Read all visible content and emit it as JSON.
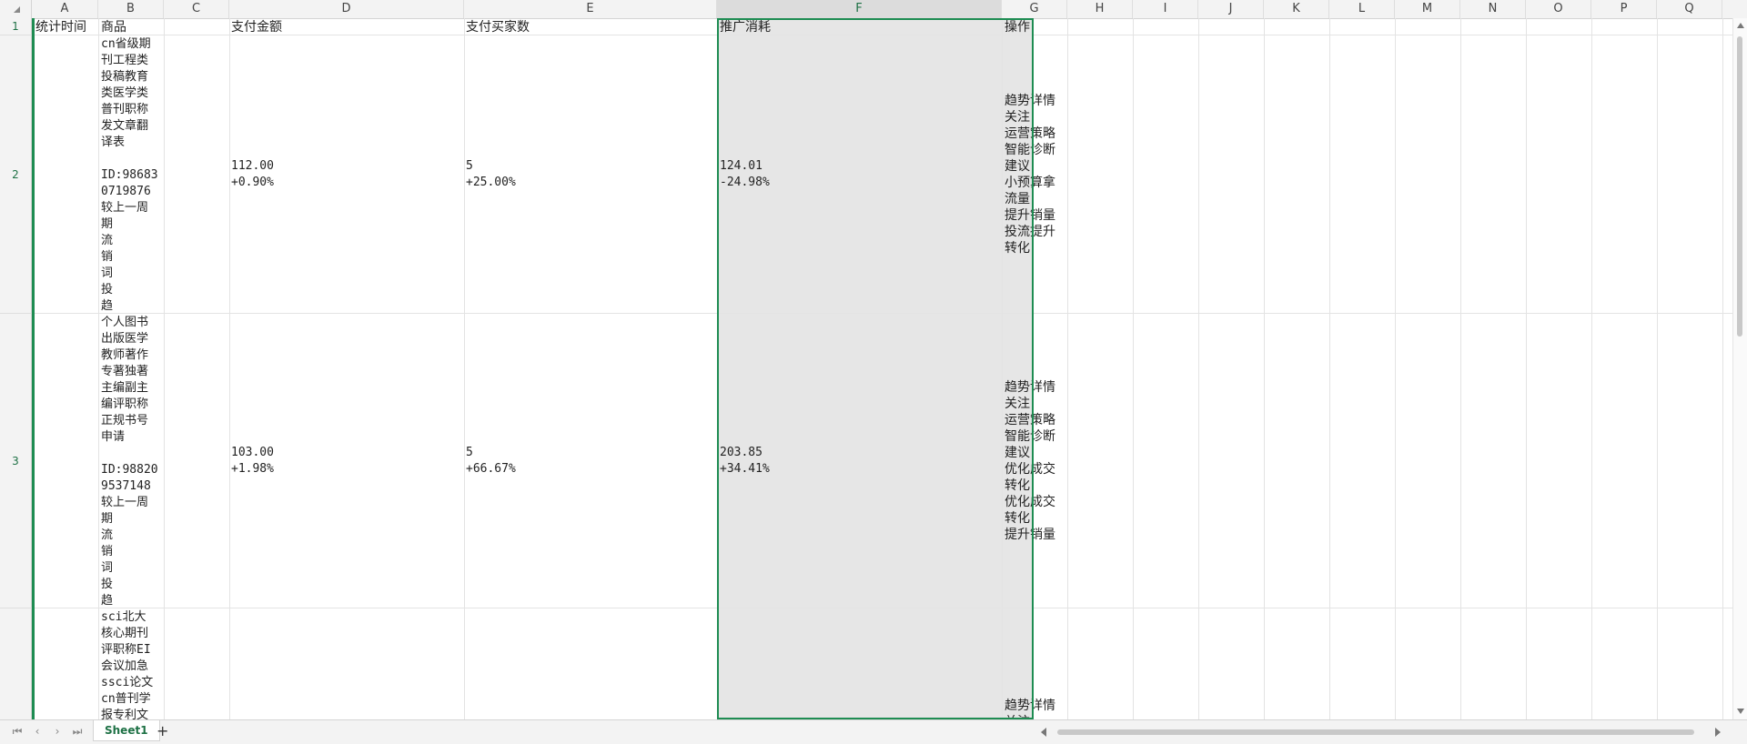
{
  "columns": [
    "A",
    "B",
    "C",
    "D",
    "E",
    "F",
    "G",
    "H",
    "I",
    "J",
    "K",
    "L",
    "M",
    "N",
    "O",
    "P",
    "Q"
  ],
  "selected_column": "F",
  "rows": [
    "1",
    "2",
    "3"
  ],
  "header_row": {
    "A": "统计时间",
    "B": "商品",
    "D": "支付金额",
    "E": "支付买家数",
    "F": "推广消耗",
    "G": "操作"
  },
  "row2": {
    "B": "cn省级期\n刊工程类\n投稿教育\n类医学类\n普刊职称\n发文章翻\n译表\n\nID:98683\n0719876\n较上一周\n期\n流\n销\n词\n投\n趋",
    "D": "112.00\n+0.90%",
    "E": "5\n+25.00%",
    "F": "124.01\n-24.98%",
    "G": "趋势详情\n关注\n运营策略\n智能诊断\n建议\n小预算拿\n流量\n提升销量\n投流提升\n转化"
  },
  "row3": {
    "B": "个人图书\n出版医学\n教师著作\n专著独著\n主编副主\n编评职称\n正规书号\n申请\n\nID:98820\n9537148\n较上一周\n期\n流\n销\n词\n投\n趋",
    "D": "103.00\n+1.98%",
    "E": "5\n+66.67%",
    "F": "203.85\n+34.41%",
    "G": "趋势详情\n关注\n运营策略\n智能诊断\n建议\n优化成交\n转化\n优化成交\n转化\n提升销量"
  },
  "row4": {
    "B": "sci北大\n核心期刊\n评职称EI\n会议加急\nssci论文\ncn普刊学\n报专利文",
    "G": "趋势详情\n关注"
  },
  "sheet_tabs": [
    "Sheet1"
  ],
  "add_tab_label": "+",
  "colors": {
    "accent": "#1e8c52",
    "selected_col_bg": "#e6e6e6"
  }
}
